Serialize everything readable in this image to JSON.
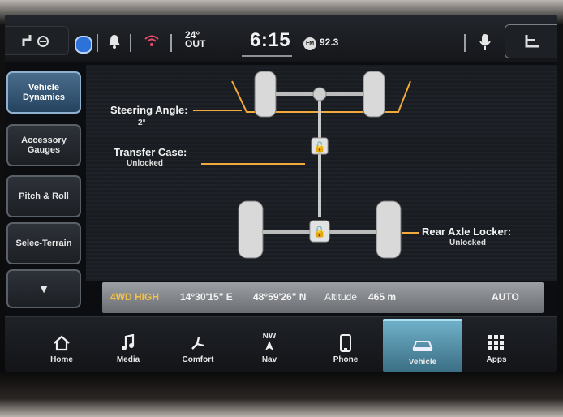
{
  "status": {
    "temp_value": "24°",
    "temp_label": "OUT",
    "clock": "6:15",
    "radio_band": "FM",
    "radio_freq": "92.3"
  },
  "side_menu": [
    {
      "label": "Vehicle Dynamics"
    },
    {
      "label": "Accessory Gauges"
    },
    {
      "label": "Pitch & Roll"
    },
    {
      "label": "Selec-Terrain"
    },
    {
      "label": "▼"
    }
  ],
  "dynamics": {
    "steering_title": "Steering Angle:",
    "steering_value": "2°",
    "transfer_title": "Transfer Case:",
    "transfer_value": "Unlocked",
    "rear_title": "Rear Axle Locker:",
    "rear_value": "Unlocked"
  },
  "info_bar": {
    "mode": "4WD HIGH",
    "longitude": "14°30'15\" E",
    "latitude": "48°59'26\" N",
    "altitude_label": "Altitude",
    "altitude_value": "465 m",
    "auto": "AUTO"
  },
  "nav": {
    "compass_top": "NW",
    "items": [
      {
        "label": "Home"
      },
      {
        "label": "Media"
      },
      {
        "label": "Comfort"
      },
      {
        "label": "Nav"
      },
      {
        "label": "Phone"
      },
      {
        "label": "Vehicle"
      },
      {
        "label": "Apps"
      }
    ]
  },
  "colors": {
    "accent_orange": "#f2a93b",
    "mode_yellow": "#f0c24a",
    "active_tab": "#4a6d8c"
  }
}
